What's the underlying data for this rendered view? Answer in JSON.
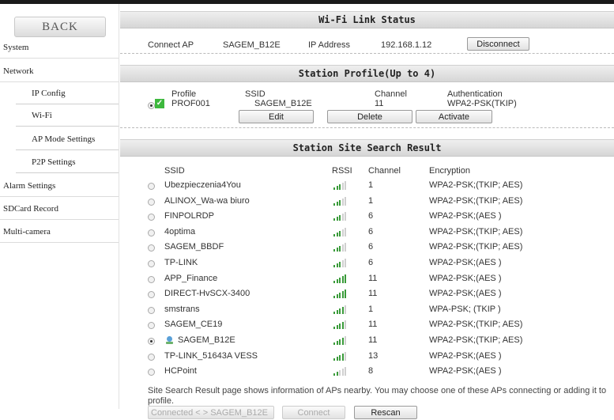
{
  "sidebar": {
    "back_label": "BACK",
    "items": [
      {
        "label": "System"
      },
      {
        "label": "Network"
      },
      {
        "label": "IP Config"
      },
      {
        "label": "Wi-Fi"
      },
      {
        "label": "AP Mode Settings"
      },
      {
        "label": "P2P Settings"
      },
      {
        "label": "Alarm Settings"
      },
      {
        "label": "SDCard Record"
      },
      {
        "label": "Multi-camera"
      }
    ]
  },
  "link_status": {
    "title": "Wi-Fi Link Status",
    "connect_ap_label": "Connect AP",
    "connect_ap_value": "SAGEM_B12E",
    "ip_label": "IP Address",
    "ip_value": "192.168.1.12",
    "disconnect_label": "Disconnect"
  },
  "station_profile": {
    "title": "Station Profile(Up to 4)",
    "headers": {
      "profile": "Profile",
      "ssid": "SSID",
      "channel": "Channel",
      "auth": "Authentication"
    },
    "row": {
      "profile": "PROF001",
      "ssid": "SAGEM_B12E",
      "channel": "11",
      "auth": "WPA2-PSK(TKIP)"
    },
    "edit_label": "Edit",
    "delete_label": "Delete",
    "activate_label": "Activate"
  },
  "site_search": {
    "title": "Station Site Search Result",
    "headers": {
      "ssid": "SSID",
      "rssi": "RSSI",
      "channel": "Channel",
      "encryption": "Encryption"
    },
    "rows": [
      {
        "ssid": "Ubezpieczenia4You",
        "channel": "1",
        "encryption": "WPA2-PSK;(TKIP; AES)",
        "signal": 3,
        "selected": false
      },
      {
        "ssid": "ALINOX_Wa-wa biuro",
        "channel": "1",
        "encryption": "WPA2-PSK;(TKIP; AES)",
        "signal": 3,
        "selected": false
      },
      {
        "ssid": "FINPOLRDP",
        "channel": "6",
        "encryption": "WPA2-PSK;(AES )",
        "signal": 3,
        "selected": false
      },
      {
        "ssid": "4optima",
        "channel": "6",
        "encryption": "WPA2-PSK;(TKIP; AES)",
        "signal": 3,
        "selected": false
      },
      {
        "ssid": "SAGEM_BBDF",
        "channel": "6",
        "encryption": "WPA2-PSK;(TKIP; AES)",
        "signal": 3,
        "selected": false
      },
      {
        "ssid": "TP-LINK",
        "channel": "6",
        "encryption": "WPA2-PSK;(AES )",
        "signal": 3,
        "selected": false
      },
      {
        "ssid": "APP_Finance",
        "channel": "11",
        "encryption": "WPA2-PSK;(AES )",
        "signal": 5,
        "selected": false
      },
      {
        "ssid": "DIRECT-HvSCX-3400",
        "channel": "11",
        "encryption": "WPA2-PSK;(AES )",
        "signal": 5,
        "selected": false
      },
      {
        "ssid": "smstrans",
        "channel": "1",
        "encryption": "WPA-PSK; (TKIP )",
        "signal": 4,
        "selected": false
      },
      {
        "ssid": "SAGEM_CE19",
        "channel": "11",
        "encryption": "WPA2-PSK;(TKIP; AES)",
        "signal": 4,
        "selected": false
      },
      {
        "ssid": "SAGEM_B12E",
        "channel": "11",
        "encryption": "WPA2-PSK;(TKIP; AES)",
        "signal": 4,
        "selected": true,
        "connected_icon": "network-user-icon"
      },
      {
        "ssid": "TP-LINK_51643A VESS",
        "channel": "13",
        "encryption": "WPA2-PSK;(AES )",
        "signal": 4,
        "selected": false
      },
      {
        "ssid": "HCPoint",
        "channel": "8",
        "encryption": "WPA2-PSK;(AES )",
        "signal": 2,
        "selected": false
      }
    ],
    "note": "Site Search Result page shows information of APs nearby. You may choose one of these APs connecting or adding it to profile.",
    "connected_field": "Connected < > SAGEM_B12E",
    "connect_label": "Connect",
    "rescan_label": "Rescan"
  },
  "colors": {
    "signal_on": "#3a9b3a",
    "signal_off": "#d0d0d0",
    "check": "#3db83d"
  }
}
